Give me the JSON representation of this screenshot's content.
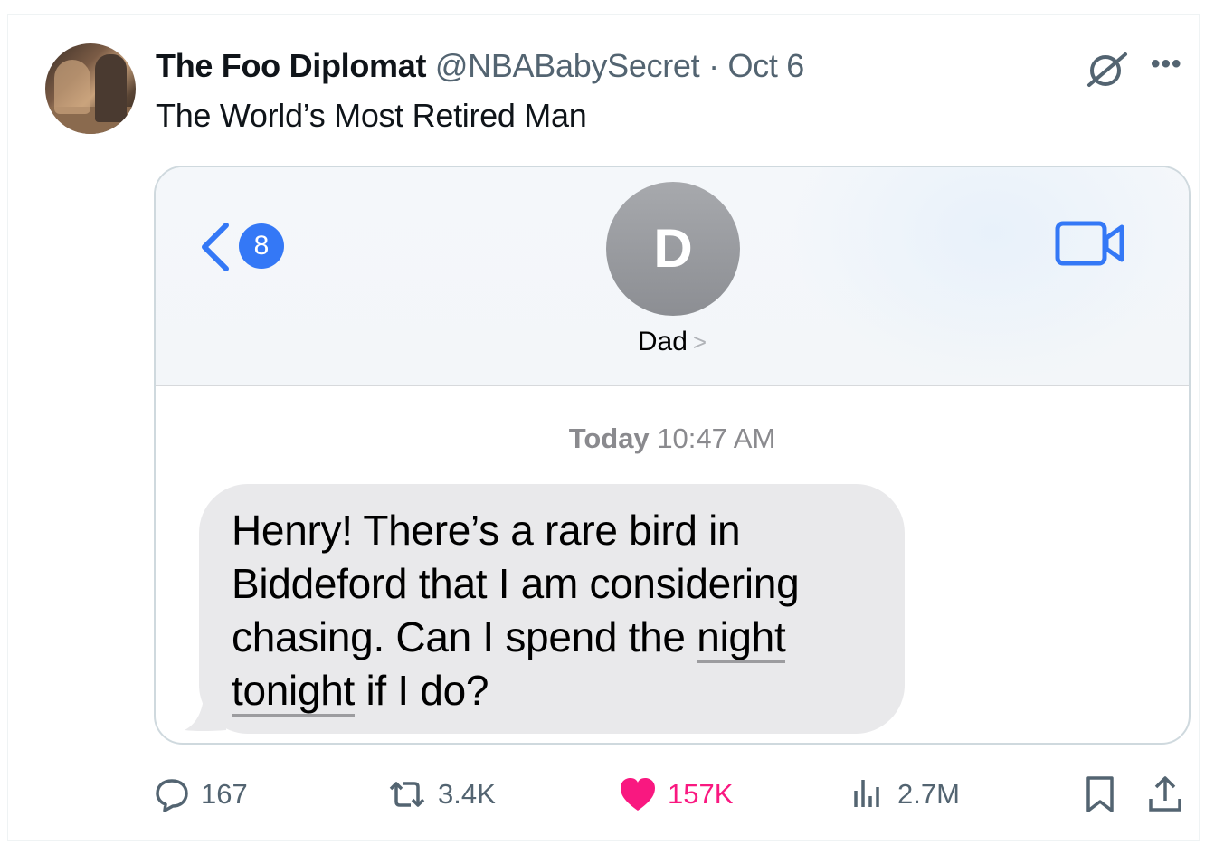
{
  "tweet": {
    "display_name": "The Foo Diplomat",
    "handle": "@NBABabySecret",
    "separator": "·",
    "date": "Oct 6",
    "text": "The World’s Most Retired Man"
  },
  "message_screen": {
    "back_badge_count": "8",
    "contact_initial": "D",
    "contact_name": "Dad",
    "timestamp_day": "Today",
    "timestamp_time": "10:47 AM",
    "message": {
      "line1": "Henry!  There’s a rare bird in",
      "line2": "Biddeford that I am considering",
      "line3_a": "chasing. Can I spend the ",
      "line3_b": "night",
      "line4_a": "tonight",
      "line4_b": " if I do?"
    },
    "colors": {
      "ios_blue": "#3478f6",
      "bubble_gray": "#e9e9eb",
      "avatar_gray": "#9a9ca0"
    }
  },
  "actions": {
    "replies": "167",
    "reposts": "3.4K",
    "likes": "157K",
    "views": "2.7M"
  },
  "icons": [
    "grok-icon",
    "more-icon",
    "back-chevron-icon",
    "video-call-icon",
    "reply-icon",
    "repost-icon",
    "heart-icon",
    "views-icon",
    "bookmark-icon",
    "share-icon"
  ],
  "colors": {
    "like_pink": "#f91880",
    "secondary_text": "#536471",
    "text": "#0f1419"
  }
}
